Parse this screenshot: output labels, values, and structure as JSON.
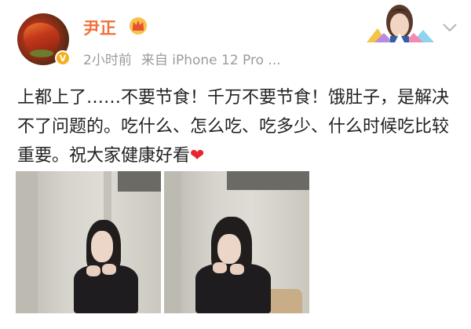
{
  "post": {
    "username": "尹正",
    "time": "2小时前",
    "source": "来自 iPhone 12 Pro ...",
    "text": "上都上了……不要节食！千万不要节食！饿肚子，是解决不了问题的。吃什么、怎么吃、吃多少、什么时候吃比较重要。祝大家健康好看",
    "verified_mark": "V"
  },
  "icons": {
    "avatar": "food-avatar",
    "verified": "verified-badge-icon",
    "crown": "crown-icon",
    "decoration": "card-decoration",
    "more": "chevron-down-icon",
    "heart": "red-heart-icon"
  },
  "colors": {
    "username": "#f0703a",
    "meta": "#9b9b9b",
    "heart": "#e5262d",
    "verified": "#f4b01c"
  }
}
